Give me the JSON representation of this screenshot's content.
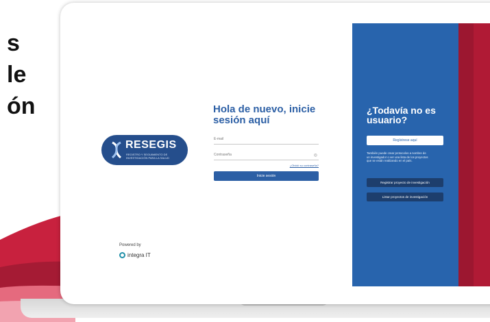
{
  "background": {
    "lines": [
      "s",
      "le",
      "ón"
    ],
    "colors": {
      "accent_red": "#c8213e",
      "accent_dark_red": "#a51b34",
      "light_red": "#e56a7e"
    }
  },
  "brand": {
    "logo_title": "RESEGIS",
    "logo_subtitle": "REGISTRO Y SEGUIMIENTO DE INVESTIGACIÓN PARA LA SALUD",
    "powered_by": "Powered by",
    "integra": "integra IT"
  },
  "login": {
    "greeting": "Hola de nuevo, inicie sesión aquí",
    "email_placeholder": "E-mail",
    "password_placeholder": "Contraseña",
    "forgot_password": "¿Olvidó su contraseña?",
    "submit_label": "Inicie sesión"
  },
  "signup": {
    "title": "¿Todavía no es usuario?",
    "register_label": "Regístrese aquí",
    "description": "También puede crear protocolos a nombre de un investigador o ver una lista de los proyectos que se están realizando en el país.",
    "register_project_label": "Registrar proyecto de investigación",
    "list_projects_label": "Listar proyectos de investigación"
  },
  "colors": {
    "primary_blue": "#2864ad",
    "dark_blue": "#1d3e6d",
    "logo_blue": "#254e8c",
    "panel_red": "#b01a35"
  }
}
